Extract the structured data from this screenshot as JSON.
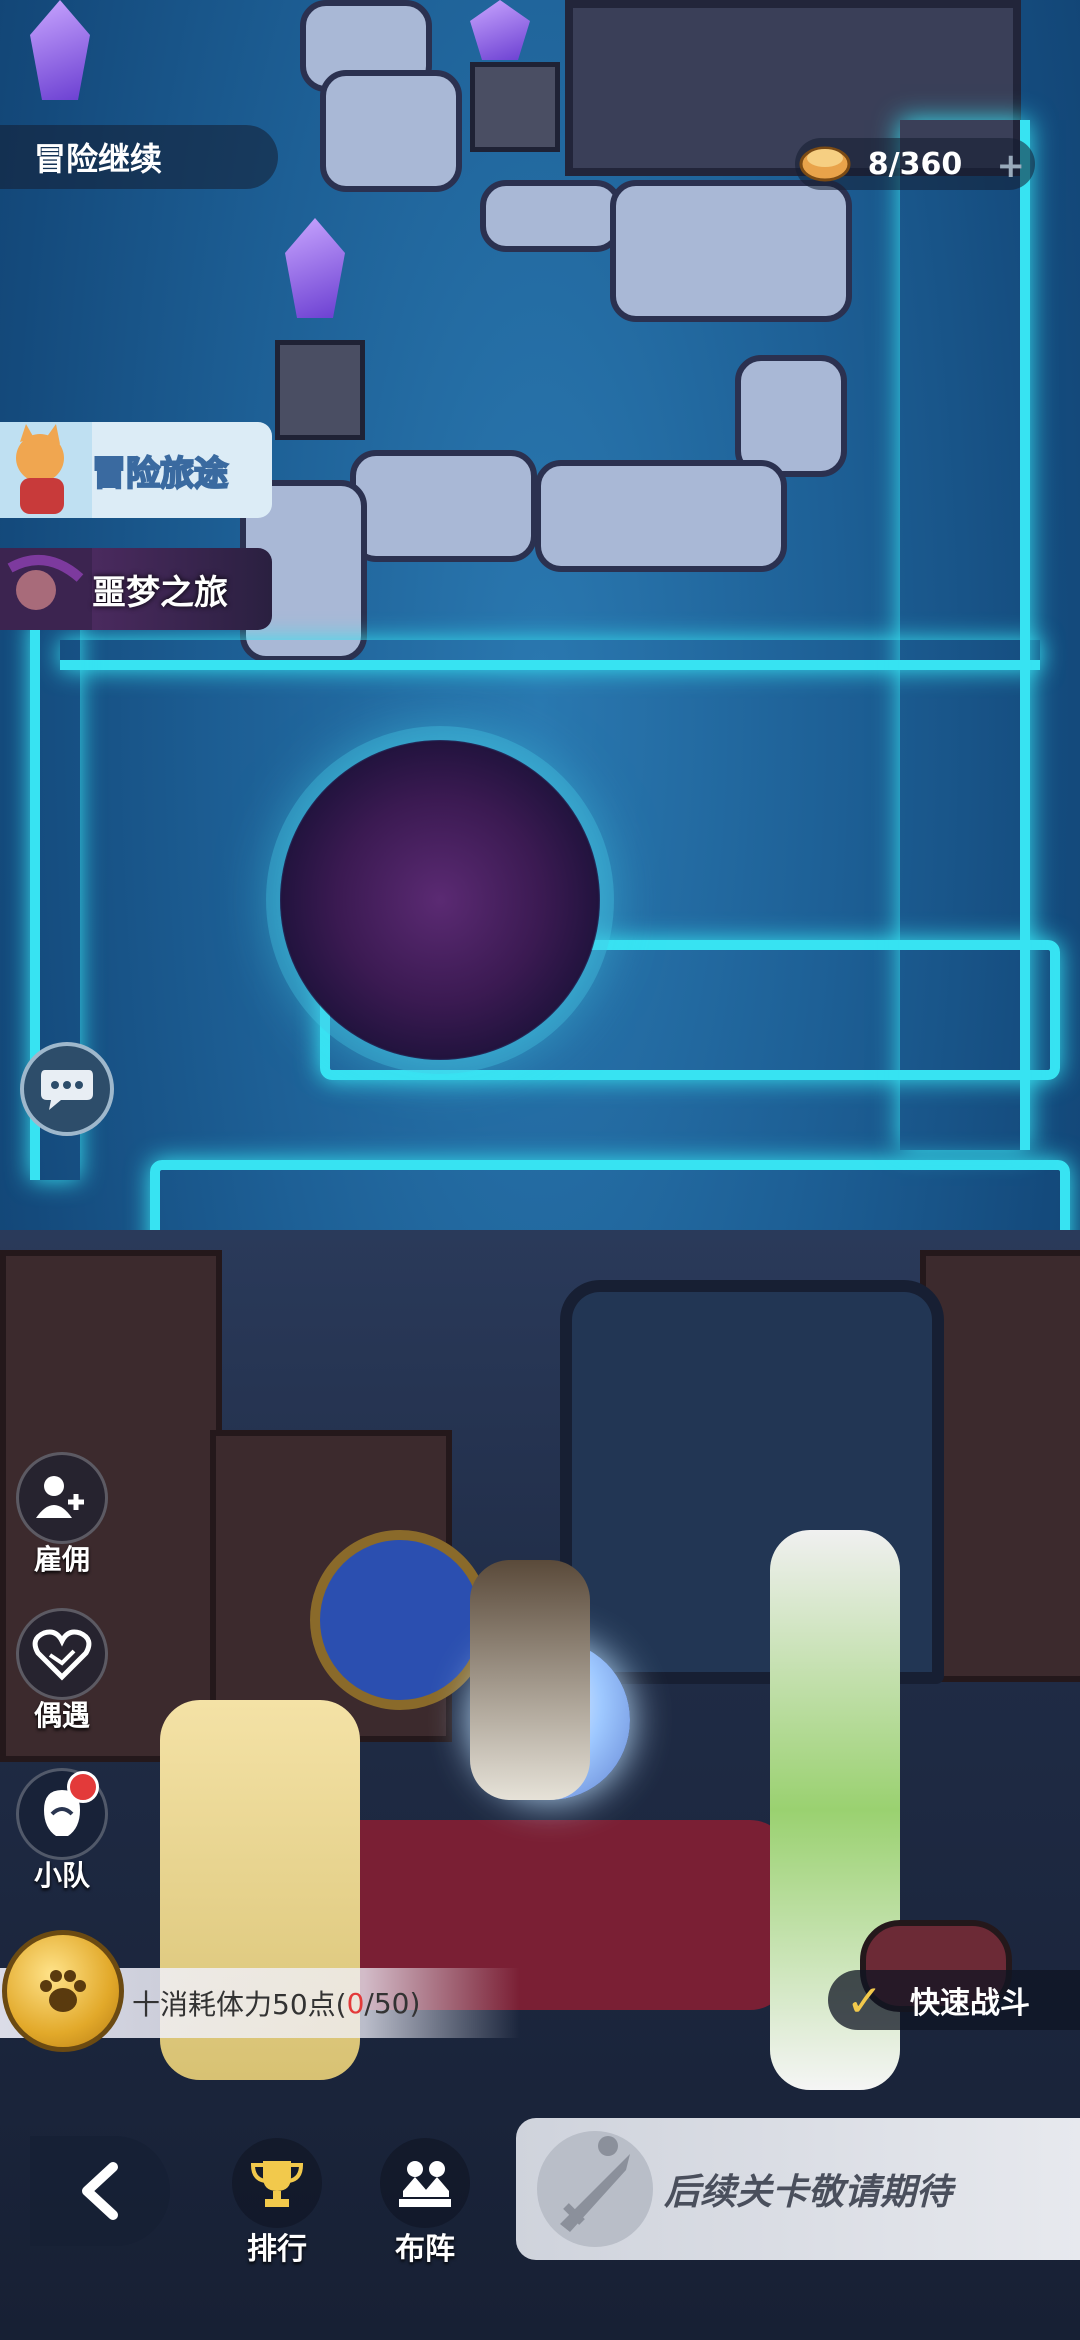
{
  "top": {
    "adventure_continue": "冒险继续",
    "stamina": "8/360",
    "stamina_plus": "+"
  },
  "side_cards": {
    "journey": "冒险旅途",
    "dream": "噩梦之旅"
  },
  "side_buttons": [
    {
      "label": "雇佣",
      "icon": "hire-icon"
    },
    {
      "label": "偶遇",
      "icon": "encounter-icon"
    },
    {
      "label": "小队",
      "icon": "team-icon",
      "badge": true
    }
  ],
  "cost": {
    "prefix": "十消耗体力50点(",
    "current": "0",
    "suffix": "/50)"
  },
  "quick_battle": "快速战斗",
  "bottom": {
    "rank": "排行",
    "formation": "布阵",
    "next_stage": "后续关卡敬请期待"
  },
  "colors": {
    "glow": "#37e3f2",
    "cost_highlight": "#e33a3a",
    "quick_check": "#f2c94c"
  }
}
